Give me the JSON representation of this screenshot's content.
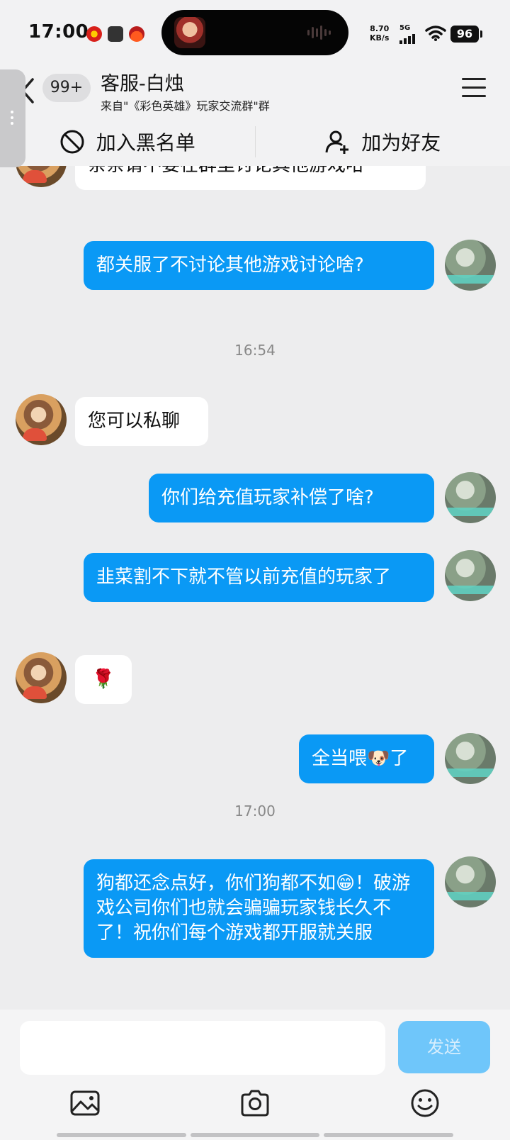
{
  "status_bar": {
    "time": "17:00",
    "net_speed_value": "8.70",
    "net_speed_unit": "KB/s",
    "network": "5G",
    "battery": "96"
  },
  "header": {
    "unread_count": "99+",
    "title": "客服-白烛",
    "subtitle": "来自\"《彩色英雄》玩家交流群\"群",
    "menu_icon": "hamburger-icon"
  },
  "actions": {
    "blacklist": "加入黑名单",
    "add_friend": "加为好友"
  },
  "messages": [
    {
      "side": "in",
      "text": "亲亲请不要在群里讨论其他游戏哈"
    },
    {
      "side": "out",
      "text": "都关服了不讨论其他游戏讨论啥?"
    },
    {
      "side": "in",
      "text": "您可以私聊"
    },
    {
      "side": "out",
      "text": "你们给充值玩家补偿了啥?"
    },
    {
      "side": "out",
      "text": "韭菜割不下就不管以前充值的玩家了"
    },
    {
      "side": "in",
      "text": "🌹"
    },
    {
      "side": "out",
      "text": "全当喂🐶了"
    },
    {
      "side": "out",
      "text": "狗都还念点好，你们狗都不如😁！破游戏公司你们也就会骗骗玩家钱长久不了！祝你们每个游戏都开服就关服"
    }
  ],
  "timestamps": [
    "16:54",
    "17:00"
  ],
  "composer": {
    "input_value": "",
    "send_label": "发送",
    "tools": [
      "image-icon",
      "camera-icon",
      "emoji-icon"
    ]
  }
}
